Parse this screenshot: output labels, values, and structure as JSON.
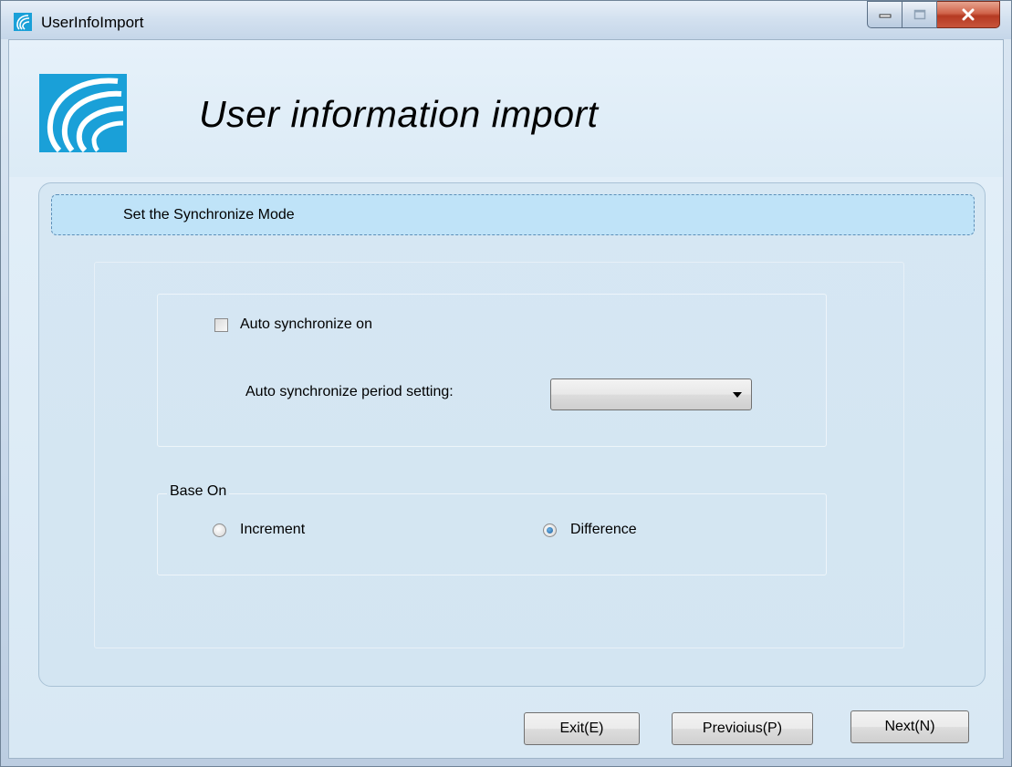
{
  "window": {
    "title": "UserInfoImport",
    "controls": [
      "minimize-icon",
      "maximize-icon",
      "close-icon"
    ]
  },
  "header": {
    "title": "User information import"
  },
  "step": {
    "label": "Set the Synchronize  Mode"
  },
  "sync": {
    "auto_checkbox_label": "Auto synchronize on",
    "auto_checked": false,
    "period_label": "Auto synchronize period setting:",
    "period_value": ""
  },
  "base_on": {
    "legend": "Base On",
    "options": [
      {
        "label": "Increment",
        "checked": false
      },
      {
        "label": "Difference",
        "checked": true
      }
    ]
  },
  "footer": {
    "exit_label": "Exit(E)",
    "previous_label": "Previoius(P)",
    "next_label": "Next(N)"
  },
  "colors": {
    "banner": "#bfe3f8",
    "banner_border": "#5c8fb8",
    "logo": "#1aa0d8",
    "close_button": "#c7543b"
  }
}
